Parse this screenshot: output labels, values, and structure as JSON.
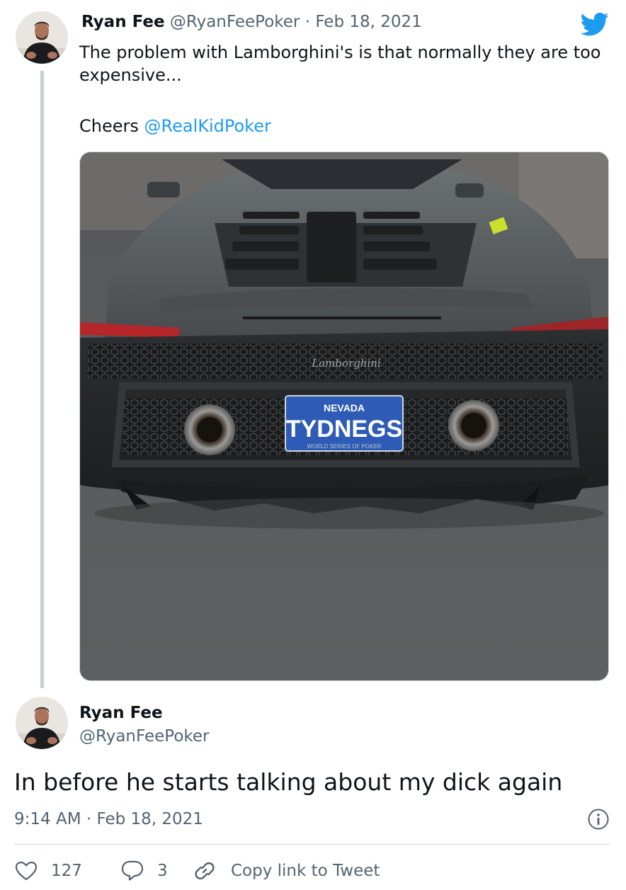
{
  "tweet1": {
    "author_name": "Ryan Fee",
    "author_handle": "@RyanFeePoker",
    "separator": "·",
    "date": "Feb 18, 2021",
    "text": "The problem with Lamborghini's is that normally they are too expensive...",
    "cheers_prefix": "Cheers ",
    "mention": "@RealKidPoker",
    "photo": {
      "badge_text": "Lamborghini",
      "plate_state": "NEVADA",
      "plate_number": "TYDNEGS",
      "plate_frame": "WORLD SERIES OF POKER"
    }
  },
  "tweet2": {
    "author_name": "Ryan Fee",
    "author_handle": "@RyanFeePoker",
    "text": "In before he starts talking about my dick again",
    "timestamp": "9:14 AM · Feb 18, 2021"
  },
  "actions": {
    "likes": "127",
    "replies": "3",
    "copy_link": "Copy link to Tweet"
  },
  "icons": {
    "logo": "twitter-bird-icon",
    "info": "info-icon",
    "like": "heart-icon",
    "reply": "reply-icon",
    "link": "link-icon"
  },
  "colors": {
    "brand": "#1d9bf0",
    "muted": "#536471",
    "text": "#0f1419",
    "thread_line": "#c4cfd6"
  }
}
